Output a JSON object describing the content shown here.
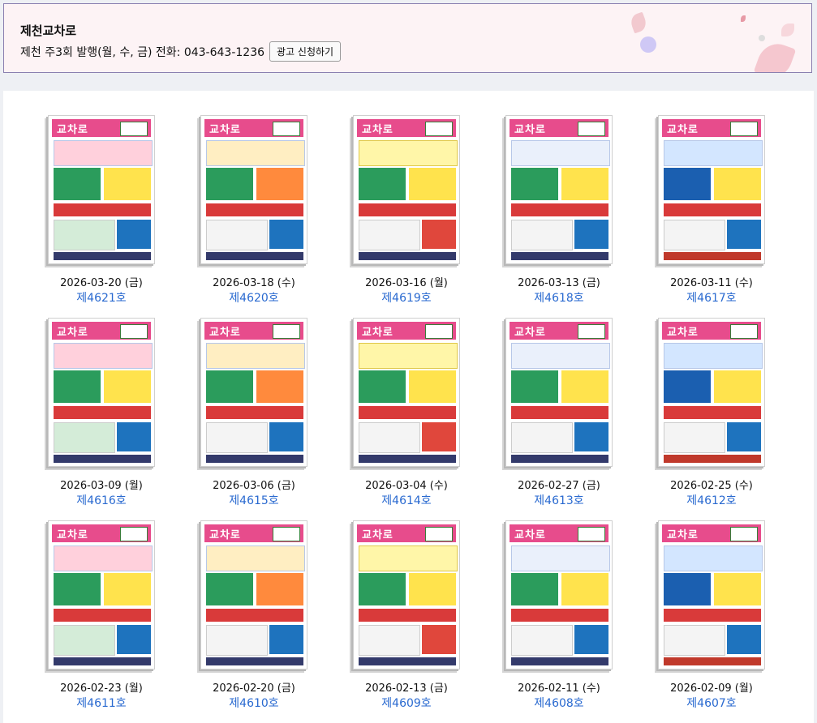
{
  "header": {
    "title": "제천교차로",
    "info": "제천 주3회 발행(월, 수, 금) 전화: 043-643-1236",
    "ad_button": "광고 신청하기"
  },
  "issues": [
    {
      "date": "2026-03-20 (금)",
      "issue": "제4621호"
    },
    {
      "date": "2026-03-18 (수)",
      "issue": "제4620호"
    },
    {
      "date": "2026-03-16 (월)",
      "issue": "제4619호"
    },
    {
      "date": "2026-03-13 (금)",
      "issue": "제4618호"
    },
    {
      "date": "2026-03-11 (수)",
      "issue": "제4617호"
    },
    {
      "date": "2026-03-09 (월)",
      "issue": "제4616호"
    },
    {
      "date": "2026-03-06 (금)",
      "issue": "제4615호"
    },
    {
      "date": "2026-03-04 (수)",
      "issue": "제4614호"
    },
    {
      "date": "2026-02-27 (금)",
      "issue": "제4613호"
    },
    {
      "date": "2026-02-25 (수)",
      "issue": "제4612호"
    },
    {
      "date": "2026-02-23 (월)",
      "issue": "제4611호"
    },
    {
      "date": "2026-02-20 (금)",
      "issue": "제4610호"
    },
    {
      "date": "2026-02-13 (금)",
      "issue": "제4609호"
    },
    {
      "date": "2026-02-11 (수)",
      "issue": "제4608호"
    },
    {
      "date": "2026-02-09 (월)",
      "issue": "제4607호"
    }
  ],
  "masthead": "교차로",
  "colors": {
    "masthead": "#e74c8c",
    "link": "#2a6ad0",
    "header_border": "#8a7fb0"
  }
}
